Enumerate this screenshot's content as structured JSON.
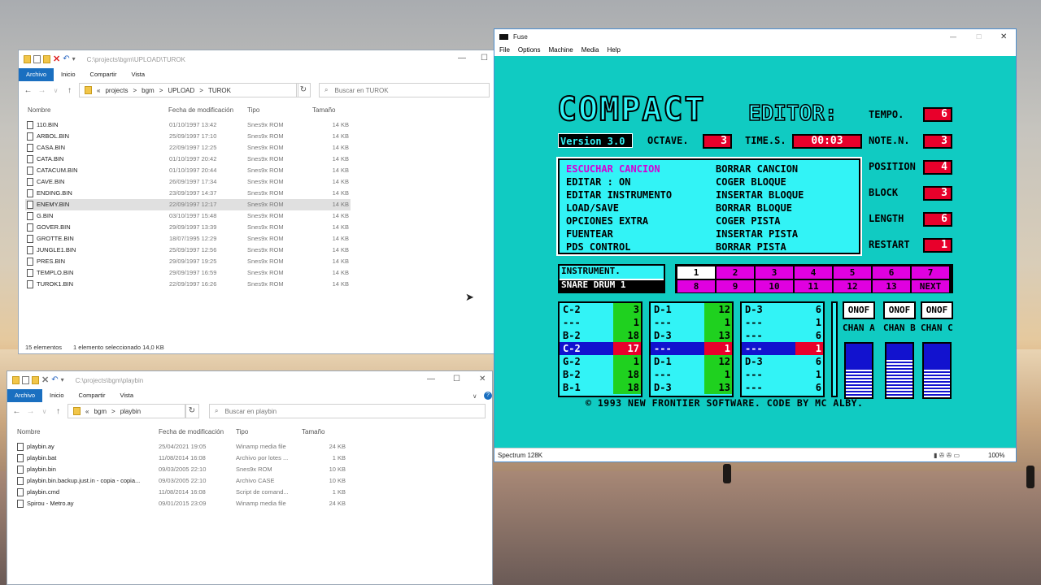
{
  "explorer1": {
    "title_path": "C:\\projects\\bgm\\UPLOAD\\TUROK",
    "ribbon": [
      "Archivo",
      "Inicio",
      "Compartir",
      "Vista"
    ],
    "breadcrumb": [
      "«",
      "projects",
      ">",
      "bgm",
      ">",
      "UPLOAD",
      ">",
      "TUROK"
    ],
    "search_placeholder": "Buscar en TUROK",
    "columns": [
      "Nombre",
      "Fecha de modificación",
      "Tipo",
      "Tamaño"
    ],
    "files": [
      {
        "name": "110.BIN",
        "date": "01/10/1997 13:42",
        "type": "Snes9x ROM",
        "size": "14 KB"
      },
      {
        "name": "ARBOL.BIN",
        "date": "25/09/1997 17:10",
        "type": "Snes9x ROM",
        "size": "14 KB"
      },
      {
        "name": "CASA.BIN",
        "date": "22/09/1997 12:25",
        "type": "Snes9x ROM",
        "size": "14 KB"
      },
      {
        "name": "CATA.BIN",
        "date": "01/10/1997 20:42",
        "type": "Snes9x ROM",
        "size": "14 KB"
      },
      {
        "name": "CATACUM.BIN",
        "date": "01/10/1997 20:44",
        "type": "Snes9x ROM",
        "size": "14 KB"
      },
      {
        "name": "CAVE.BIN",
        "date": "26/09/1997 17:34",
        "type": "Snes9x ROM",
        "size": "14 KB"
      },
      {
        "name": "ENDING.BIN",
        "date": "23/09/1997 14:37",
        "type": "Snes9x ROM",
        "size": "14 KB"
      },
      {
        "name": "ENEMY.BIN",
        "date": "22/09/1997 12:17",
        "type": "Snes9x ROM",
        "size": "14 KB"
      },
      {
        "name": "G.BIN",
        "date": "03/10/1997 15:48",
        "type": "Snes9x ROM",
        "size": "14 KB"
      },
      {
        "name": "GOVER.BIN",
        "date": "29/09/1997 13:39",
        "type": "Snes9x ROM",
        "size": "14 KB"
      },
      {
        "name": "GROTTE.BIN",
        "date": "18/07/1995 12:29",
        "type": "Snes9x ROM",
        "size": "14 KB"
      },
      {
        "name": "JUNGLE1.BIN",
        "date": "25/09/1997 12:56",
        "type": "Snes9x ROM",
        "size": "14 KB"
      },
      {
        "name": "PRES.BIN",
        "date": "29/09/1997 19:25",
        "type": "Snes9x ROM",
        "size": "14 KB"
      },
      {
        "name": "TEMPLO.BIN",
        "date": "29/09/1997 16:59",
        "type": "Snes9x ROM",
        "size": "14 KB"
      },
      {
        "name": "TUROK1.BIN",
        "date": "22/09/1997 16:26",
        "type": "Snes9x ROM",
        "size": "14 KB"
      }
    ],
    "selected_index": 7,
    "status_count": "15 elementos",
    "status_sel": "1 elemento seleccionado  14,0 KB"
  },
  "explorer2": {
    "title_path": "C:\\projects\\bgm\\playbin",
    "ribbon": [
      "Archivo",
      "Inicio",
      "Compartir",
      "Vista"
    ],
    "breadcrumb": [
      "«",
      "bgm",
      ">",
      "playbin"
    ],
    "search_placeholder": "Buscar en playbin",
    "columns": [
      "Nombre",
      "Fecha de modificación",
      "Tipo",
      "Tamaño"
    ],
    "files": [
      {
        "name": "playbin.ay",
        "date": "25/04/2021 19:05",
        "type": "Winamp media file",
        "size": "24 KB"
      },
      {
        "name": "playbin.bat",
        "date": "11/08/2014 16:08",
        "type": "Archivo por lotes ...",
        "size": "1 KB"
      },
      {
        "name": "playbin.bin",
        "date": "09/03/2005 22:10",
        "type": "Snes9x ROM",
        "size": "10 KB"
      },
      {
        "name": "playbin.bin.backup.just.in - copia - copia...",
        "date": "09/03/2005 22:10",
        "type": "Archivo CASE",
        "size": "10 KB"
      },
      {
        "name": "playbin.cmd",
        "date": "11/08/2014 16:08",
        "type": "Script de comand...",
        "size": "1 KB"
      },
      {
        "name": "Spirou - Metro.ay",
        "date": "09/01/2015 23:09",
        "type": "Winamp media file",
        "size": "24 KB"
      }
    ]
  },
  "fuse": {
    "title": "Fuse",
    "menu": [
      "File",
      "Options",
      "Machine",
      "Media",
      "Help"
    ],
    "status_machine": "Spectrum 128K",
    "zoom": "100%",
    "editor": {
      "logo": "COMPACT",
      "logo2": "EDITOR:",
      "version": "Version 3.0",
      "octave_label": "OCTAVE.",
      "octave": "3",
      "time_label": "TIME.S.",
      "time": "00:03",
      "tempo_label": "TEMPO.",
      "tempo": "6",
      "noten_label": "NOTE.N.",
      "noten": "3",
      "position_label": "POSITION",
      "position": "4",
      "block_label": "BLOCK",
      "block": "3",
      "length_label": "LENGTH",
      "length": "6",
      "restart_label": "RESTART",
      "restart": "1",
      "menu_left": [
        "ESCUCHAR CANCION",
        "EDITAR : ON",
        "EDITAR INSTRUMENTO",
        "LOAD/SAVE",
        "OPCIONES EXTRA",
        "FUENTEAR",
        "PDS CONTROL"
      ],
      "menu_right": [
        "BORRAR CANCION",
        "COGER BLOQUE",
        "INSERTAR BLOQUE",
        "BORRAR BLOQUE",
        "COGER PISTA",
        "INSERTAR PISTA",
        "BORRAR PISTA"
      ],
      "instrument_label": "INSTRUMENT.",
      "instrument": "SNARE DRUM 1",
      "seq_top": [
        "1",
        "2",
        "3",
        "4",
        "5",
        "6",
        "7"
      ],
      "seq_bottom": [
        "8",
        "9",
        "10",
        "11",
        "12",
        "13",
        "NEXT"
      ],
      "channels": [
        {
          "notes": [
            "C-2",
            "---",
            "B-2",
            "C-2",
            "G-2",
            "B-2",
            "B-1"
          ],
          "vals": [
            "3",
            "1",
            "18",
            "17",
            "1",
            "18",
            "18"
          ]
        },
        {
          "notes": [
            "D-1",
            "---",
            "D-3",
            "---",
            "D-1",
            "---",
            "D-3"
          ],
          "vals": [
            "12",
            "1",
            "13",
            "1",
            "12",
            "1",
            "13"
          ]
        },
        {
          "notes": [
            "D-3",
            "---",
            "---",
            "---",
            "D-3",
            "---",
            "---"
          ],
          "vals": [
            "6",
            "1",
            "6",
            "1",
            "6",
            "1",
            "6"
          ]
        }
      ],
      "onof": [
        "ONOF",
        "ONOF",
        "ONOF"
      ],
      "chan_labels": [
        "CHAN A",
        "CHAN B",
        "CHAN C"
      ],
      "vu_levels": [
        0.45,
        0.3,
        0.45
      ],
      "copyright": "© 1993 NEW FRONTIER SOFTWARE. CODE BY MC ALBY."
    }
  }
}
